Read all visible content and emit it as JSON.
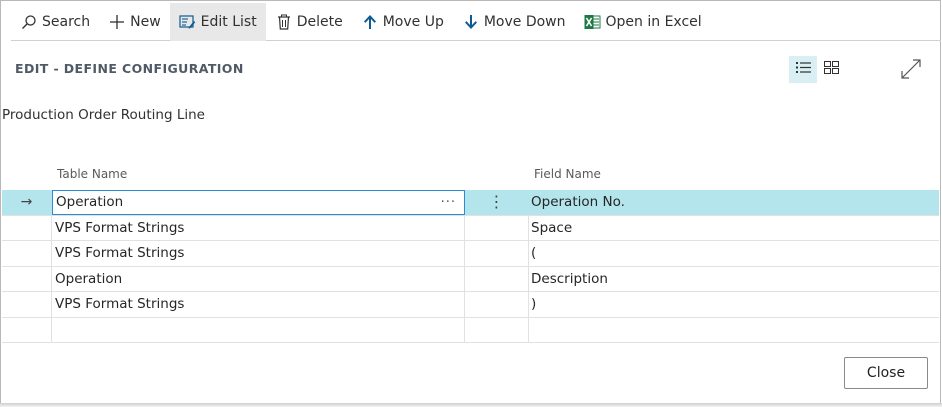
{
  "toolbar": {
    "search": "Search",
    "new": "New",
    "edit_list": "Edit List",
    "delete": "Delete",
    "move_up": "Move Up",
    "move_down": "Move Down",
    "open_in_excel": "Open in Excel"
  },
  "icons": {
    "search": "search-icon",
    "new": "plus-icon",
    "edit_list": "edit-list-icon",
    "delete": "trash-icon",
    "move_up": "arrow-up-icon",
    "move_down": "arrow-down-icon",
    "excel": "excel-icon",
    "list_view": "list-view-icon",
    "tile_view": "tile-view-icon",
    "expand": "expand-icon",
    "row_arrow": "arrow-right-icon"
  },
  "colors": {
    "selected_row": "#b4e5ec",
    "focus_border": "#2a8dd4",
    "excel_green": "#1e7a44",
    "accent": "#0d5b93"
  },
  "page": {
    "title": "EDIT - DEFINE CONFIGURATION",
    "subtitle": "Production Order Routing Line"
  },
  "grid": {
    "columns": {
      "table_name": "Table Name",
      "field_name": "Field Name"
    },
    "selected_indicator": "→",
    "rows": [
      {
        "table_name": "Operation",
        "field_name": "Operation No."
      },
      {
        "table_name": "VPS Format Strings",
        "field_name": "Space"
      },
      {
        "table_name": "VPS Format Strings",
        "field_name": "("
      },
      {
        "table_name": "Operation",
        "field_name": "Description"
      },
      {
        "table_name": "VPS Format Strings",
        "field_name": ")"
      },
      {
        "table_name": "",
        "field_name": ""
      }
    ]
  },
  "footer": {
    "close": "Close"
  }
}
